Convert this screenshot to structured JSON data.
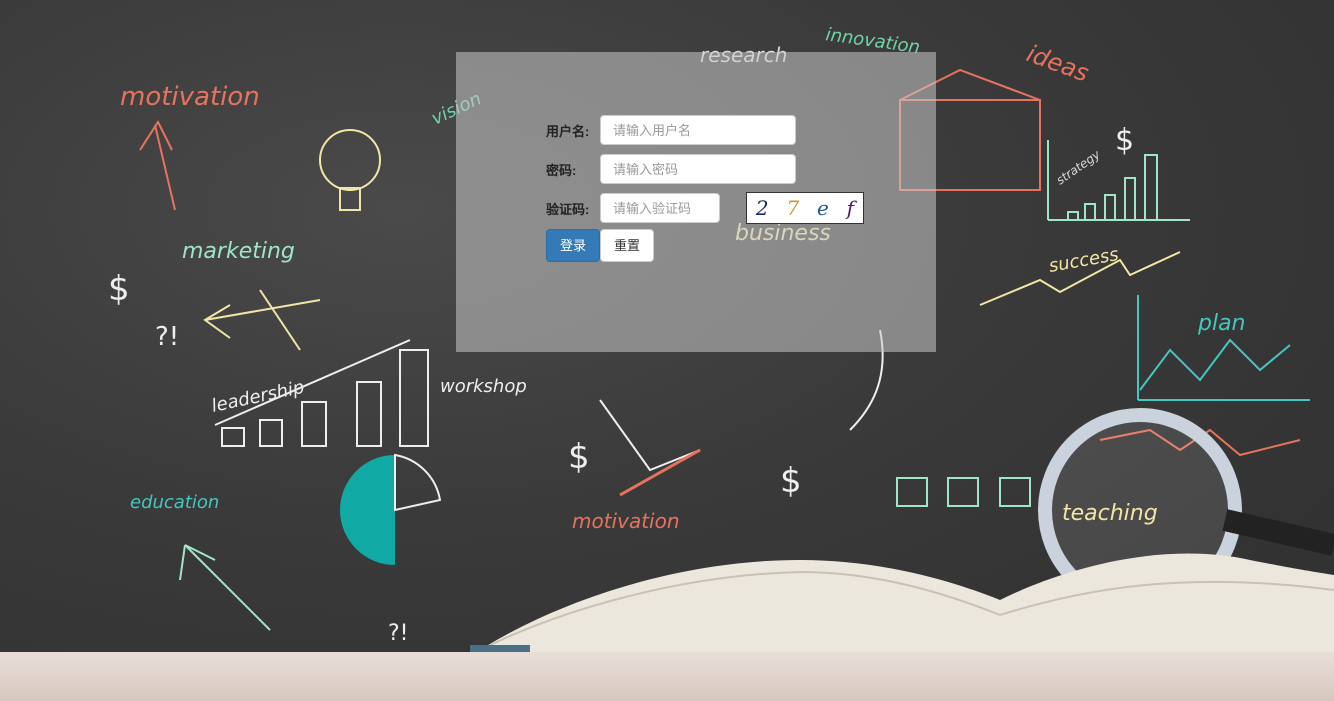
{
  "form": {
    "username_label": "用户名:",
    "username_placeholder": "请输入用户名",
    "password_label": "密码:",
    "password_placeholder": "请输入密码",
    "captcha_label": "验证码:",
    "captcha_placeholder": "请输入验证码",
    "captcha_chars": [
      "2",
      "7",
      "e",
      "f"
    ],
    "captcha_colors": [
      "#1a2a6c",
      "#c89b2a",
      "#1f5a8a",
      "#4a1a6c"
    ],
    "login_label": "登录",
    "reset_label": "重置"
  },
  "background_words": {
    "motivation": "motivation",
    "research": "research",
    "innovation": "innovation",
    "ideas": "ideas",
    "vision": "vision",
    "marketing": "marketing",
    "business": "business",
    "strategy": "strategy",
    "success": "success",
    "plan": "plan",
    "leadership": "leadership",
    "workshop": "workshop",
    "education": "education",
    "motivation2": "motivation",
    "teaching": "teaching"
  }
}
